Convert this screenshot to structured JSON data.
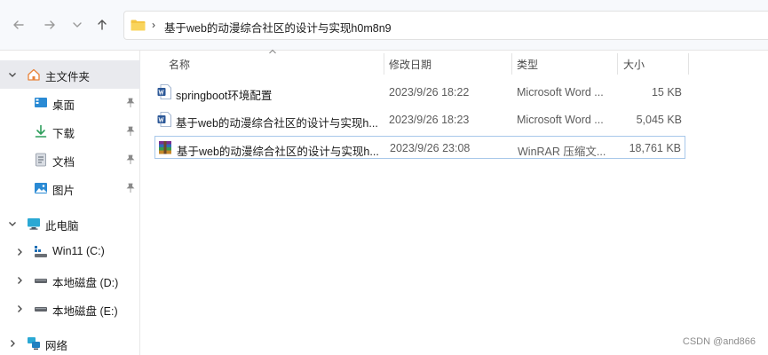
{
  "address_bar": {
    "separator": "›",
    "path": "基于web的动漫综合社区的设计与实现h0m8n9"
  },
  "sidebar": {
    "home": {
      "label": "主文件夹"
    },
    "quick_access": [
      {
        "label": "桌面",
        "icon": "desktop-icon",
        "pinned": true
      },
      {
        "label": "下载",
        "icon": "download-icon",
        "pinned": true
      },
      {
        "label": "文档",
        "icon": "document-icon",
        "pinned": true
      },
      {
        "label": "图片",
        "icon": "picture-icon",
        "pinned": true
      }
    ],
    "this_pc": {
      "label": "此电脑"
    },
    "drives": [
      {
        "label": "Win11 (C:)",
        "icon": "windows-drive-icon"
      },
      {
        "label": "本地磁盘 (D:)",
        "icon": "disk-drive-icon"
      },
      {
        "label": "本地磁盘 (E:)",
        "icon": "disk-drive-icon"
      }
    ],
    "network": {
      "label": "网络"
    }
  },
  "columns": {
    "name": "名称",
    "date": "修改日期",
    "type": "类型",
    "size": "大小"
  },
  "files": [
    {
      "name": "springboot环境配置",
      "date": "2023/9/26 18:22",
      "type": "Microsoft Word ...",
      "size": "15 KB",
      "icon": "word-doc-icon"
    },
    {
      "name": "基于web的动漫综合社区的设计与实现h...",
      "date": "2023/9/26 18:23",
      "type": "Microsoft Word ...",
      "size": "5,045 KB",
      "icon": "word-doc-icon"
    },
    {
      "name": "基于web的动漫综合社区的设计与实现h...",
      "date": "2023/9/26 23:08",
      "type": "WinRAR 压缩文...",
      "size": "18,761 KB",
      "icon": "winrar-archive-icon"
    }
  ],
  "watermark": "CSDN @and866",
  "colors": {
    "folder": "#f4c542",
    "home": "#e8833a",
    "word": "#2b5797",
    "selection": "#a8c8ea",
    "sidebar_selected": "#e9eaee"
  }
}
